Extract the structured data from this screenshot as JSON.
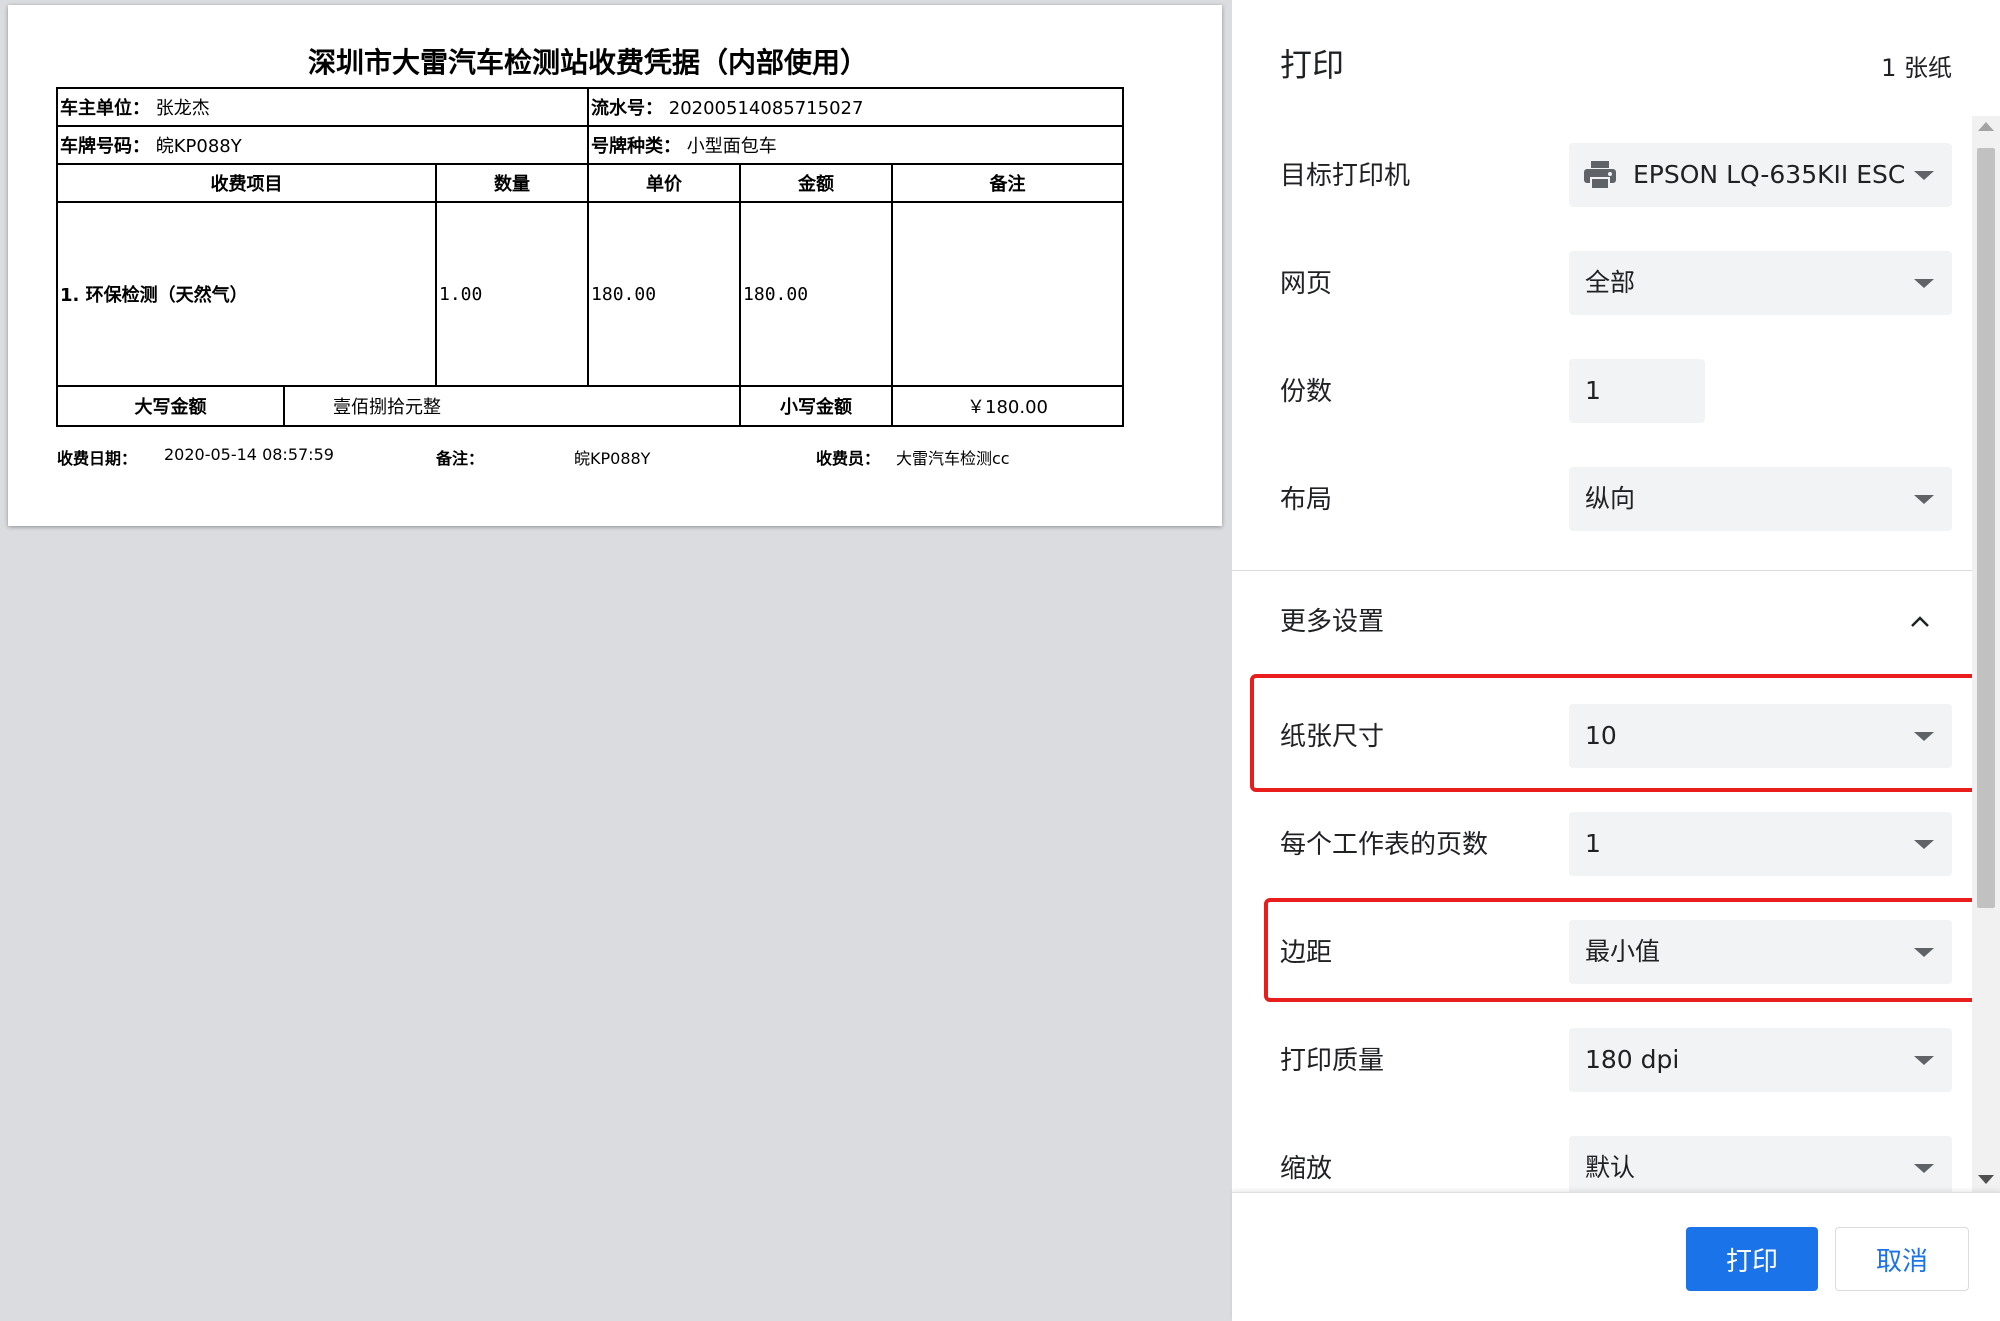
{
  "receipt": {
    "title": "深圳市大雷汽车检测站收费凭据（内部使用）",
    "owner_label": "车主单位：",
    "owner_value": "张龙杰",
    "serial_label": "流水号：",
    "serial_value": "20200514085715027",
    "plate_label": "车牌号码：",
    "plate_value": "皖KP088Y",
    "plate_type_label": "号牌种类：",
    "plate_type_value": "小型面包车",
    "columns": [
      "收费项目",
      "数量",
      "单价",
      "金额",
      "备注"
    ],
    "item": {
      "name": "1.  环保检测（天然气）",
      "qty": "1.00",
      "unit_price": "180.00",
      "amount": "180.00",
      "note": ""
    },
    "total_upper_label": "大写金额",
    "total_upper_value": "壹佰捌拾元整",
    "total_lower_label": "小写金额",
    "total_lower_value": "￥180.00",
    "footer": {
      "date_label": "收费日期：",
      "date_value": "2020-05-14 08:57:59",
      "note_label": "备注：",
      "note_value": "皖KP088Y",
      "cashier_label": "收费员：",
      "cashier_value": "大雷汽车检测cc"
    }
  },
  "panel": {
    "title": "打印",
    "sheet_count": "1 张纸",
    "printer_label": "目标打印机",
    "printer_value": "EPSON LQ-635KII ESC",
    "pages_label": "网页",
    "pages_value": "全部",
    "copies_label": "份数",
    "copies_value": "1",
    "layout_label": "布局",
    "layout_value": "纵向",
    "more_settings_label": "更多设置",
    "paper_size_label": "纸张尺寸",
    "paper_size_value": "10",
    "pages_per_sheet_label": "每个工作表的页数",
    "pages_per_sheet_value": "1",
    "margins_label": "边距",
    "margins_value": "最小值",
    "quality_label": "打印质量",
    "quality_value": "180 dpi",
    "scale_label": "缩放",
    "scale_value": "默认",
    "print_button": "打印",
    "cancel_button": "取消"
  },
  "icons": {
    "printer": "printer-icon",
    "chevron": "chevron-up-icon",
    "dropdown": "caret-down-icon"
  },
  "colors": {
    "accent": "#1a73e8",
    "highlight": "#ea1d1d",
    "field_bg": "#f1f3f4",
    "preview_bg": "#dadce0"
  }
}
